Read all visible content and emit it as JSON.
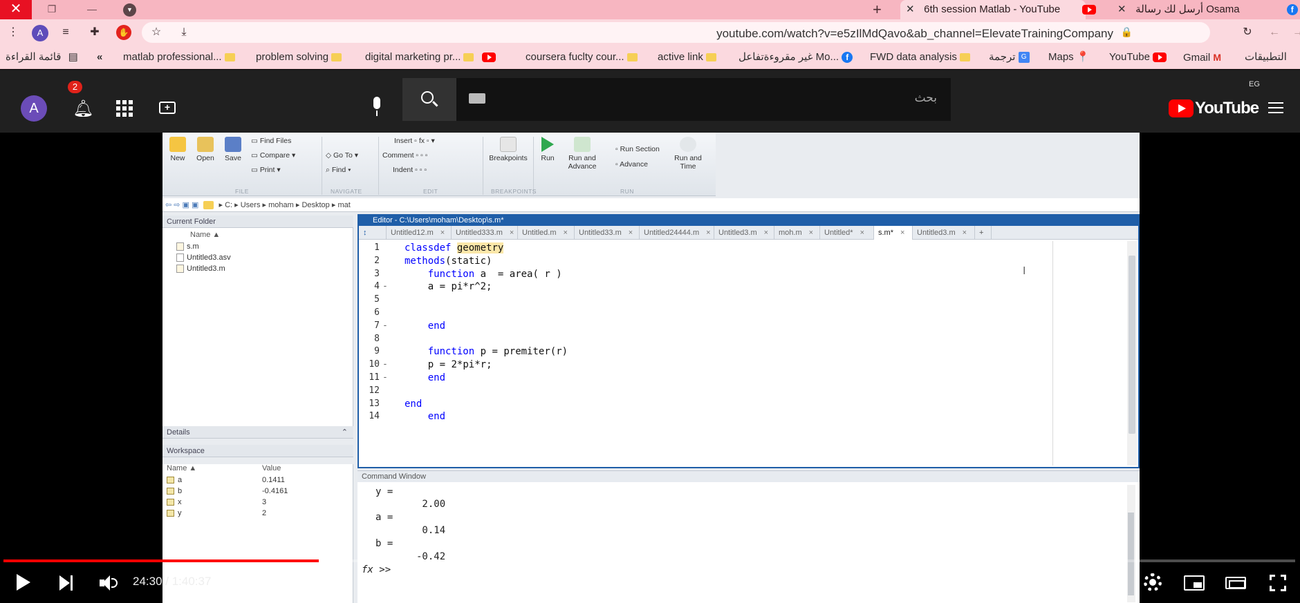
{
  "browser": {
    "new_tab_symbol": "+",
    "tabs": [
      {
        "title": "6th session Matlab - YouTube",
        "active": true
      },
      {
        "title": "أرسل لك رسالة Osama",
        "active": false
      }
    ],
    "url": "youtube.com/watch?v=e5zIlMdQavo&ab_channel=ElevateTrainingCompany",
    "profile_initial": "A",
    "bookmarks": [
      {
        "label": "التطبيقات",
        "icon": "apps-icon"
      },
      {
        "label": "Gmail",
        "icon": "gmail-icon"
      },
      {
        "label": "YouTube",
        "icon": "youtube-icon"
      },
      {
        "label": "Maps",
        "icon": "maps-icon"
      },
      {
        "label": "ترجمة",
        "icon": "translate-icon"
      },
      {
        "label": "FWD data analysis",
        "icon": "folder-icon"
      },
      {
        "label": "غير مقروءةتفاعل Mo...",
        "icon": "facebook-icon"
      },
      {
        "label": "active link",
        "icon": "folder-icon"
      },
      {
        "label": "coursera fuclty cour...",
        "icon": "folder-icon"
      },
      {
        "label": "digital marketing pr...",
        "icon": "youtube-icon"
      },
      {
        "label": "problem solving",
        "icon": "folder-icon"
      },
      {
        "label": "matlab professional...",
        "icon": "folder-icon"
      },
      {
        "label": "قائمة القراءة",
        "icon": "reading-list-icon"
      }
    ],
    "bookmarks_more": "«"
  },
  "youtube": {
    "avatar_initial": "A",
    "notification_count": "2",
    "search_placeholder": "بحث",
    "logo_text": "YouTube",
    "country_code": "EG"
  },
  "matlab": {
    "toolstrip": {
      "file_buttons": [
        "New",
        "Open",
        "Save"
      ],
      "file_small": [
        "Find Files",
        "Compare",
        "Print"
      ],
      "navigate_small": [
        "Go To",
        "Find"
      ],
      "edit_small": [
        "Insert",
        "Comment",
        "Indent"
      ],
      "breakpoints": "Breakpoints",
      "run": "Run",
      "run_advance": "Run and Advance",
      "run_section": "Run Section",
      "advance": "Advance",
      "run_time": "Run and Time",
      "sections": [
        "FILE",
        "NAVIGATE",
        "EDIT",
        "BREAKPOINTS",
        "RUN"
      ]
    },
    "path": [
      "C:",
      "Users",
      "moham",
      "Desktop",
      "mat"
    ],
    "current_folder": {
      "title": "Current Folder",
      "column": "Name ▲",
      "files": [
        "s.m",
        "Untitled3.asv",
        "Untitled3.m"
      ]
    },
    "details_title": "Details",
    "workspace": {
      "title": "Workspace",
      "columns": [
        "Name ▲",
        "Value"
      ],
      "vars": [
        {
          "name": "a",
          "value": "0.1411"
        },
        {
          "name": "b",
          "value": "-0.4161"
        },
        {
          "name": "x",
          "value": "3"
        },
        {
          "name": "y",
          "value": "2"
        }
      ]
    },
    "editor": {
      "title": "Editor - C:\\Users\\moham\\Desktop\\s.m*",
      "tabs": [
        "Untitled12.m",
        "Untitled333.m",
        "Untitled.m",
        "Untitled33.m",
        "Untitled24444.m",
        "Untitled3.m",
        "moh.m",
        "Untitled*",
        "s.m*",
        "Untitled3.m"
      ],
      "active_tab": "s.m*",
      "lines": [
        {
          "n": "1",
          "mark": "",
          "text": "classdef geometry"
        },
        {
          "n": "2",
          "mark": "",
          "text": "methods(static)"
        },
        {
          "n": "3",
          "mark": "",
          "text": "    function a  = area( r )"
        },
        {
          "n": "4",
          "mark": "-",
          "text": "    a = pi*r^2;"
        },
        {
          "n": "5",
          "mark": "",
          "text": ""
        },
        {
          "n": "6",
          "mark": "",
          "text": ""
        },
        {
          "n": "7",
          "mark": "-",
          "text": "    end"
        },
        {
          "n": "8",
          "mark": "",
          "text": ""
        },
        {
          "n": "9",
          "mark": "",
          "text": "    function p = premiter(r)"
        },
        {
          "n": "10",
          "mark": "-",
          "text": "    p = 2*pi*r;"
        },
        {
          "n": "11",
          "mark": "-",
          "text": "    end"
        },
        {
          "n": "12",
          "mark": "",
          "text": ""
        },
        {
          "n": "13",
          "mark": "",
          "text": "end"
        },
        {
          "n": "14",
          "mark": "",
          "text": "    end"
        }
      ]
    },
    "command_window": {
      "title": "Command Window",
      "lines": [
        "y =",
        "        2.00",
        "a =",
        "        0.14",
        "b =",
        "       -0.42"
      ],
      "prompt": "fx >>"
    }
  },
  "player": {
    "current_time": "24:30",
    "duration": "1:40:37",
    "time_display": "24:30 / 1:40:37",
    "progress_fraction": 0.244,
    "buffered_fraction": 0.265,
    "progress_color": "#ff0000"
  }
}
